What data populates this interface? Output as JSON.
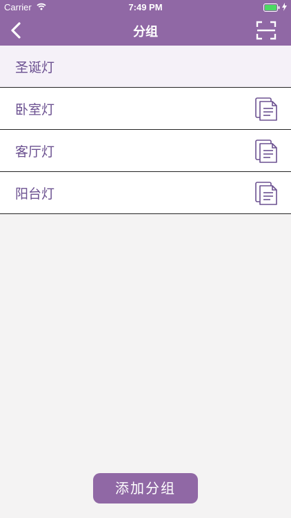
{
  "status_bar": {
    "carrier": "Carrier",
    "time": "7:49 PM"
  },
  "nav": {
    "title": "分组"
  },
  "groups": [
    {
      "label": "圣诞灯"
    },
    {
      "label": "卧室灯"
    },
    {
      "label": "客厅灯"
    },
    {
      "label": "阳台灯"
    }
  ],
  "add_button": {
    "label": "添加分组"
  },
  "colors": {
    "accent": "#9068a5",
    "text": "#6b5090",
    "background": "#f4f3f3"
  },
  "icons": {
    "back": "chevron-left-icon",
    "scan": "scan-frame-icon",
    "row_action": "document-icon",
    "wifi": "wifi-icon",
    "battery": "battery-icon"
  }
}
